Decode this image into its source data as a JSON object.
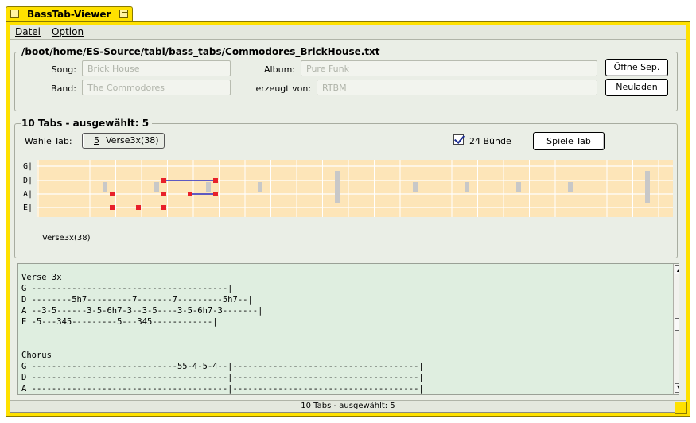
{
  "window": {
    "title": "BassTab-Viewer"
  },
  "menu": [
    {
      "label": "Datei"
    },
    {
      "label": "Option"
    }
  ],
  "info": {
    "path": "/boot/home/ES-Source/tabi/bass_tabs/Commodores_BrickHouse.txt",
    "song_label": "Song:",
    "song": "Brick House",
    "band_label": "Band:",
    "band": "The Commodores",
    "album_label": "Album:",
    "album": "Pure Funk",
    "creator_label": "erzeugt von:",
    "creator": "RTBM",
    "open_btn": "Öffne Sep.",
    "reload_btn": "Neuladen"
  },
  "tabs": {
    "header": "10 Tabs - ausgewählt:  5",
    "choose_label": "Wähle Tab:",
    "choose_num": "5",
    "choose_value": "Verse3x(38)",
    "frets_checked": true,
    "frets_label": "24 Bünde",
    "play_btn": "Spiele Tab",
    "string_labels": [
      "G|",
      "D|",
      "A|",
      "E|"
    ],
    "caption": "Verse3x(38)",
    "colors": {
      "note": "#e8202a",
      "link": "#2a2ac0",
      "marker": "#c8c8c8",
      "board": "#fde5b8"
    }
  },
  "text": {
    "content": "Verse 3x\nG|---------------------------------------|\nD|--------5h7---------7-------7---------5h7--|\nA|--3-5------3-5-6h7-3--3-5----3-5-6h7-3-------|\nE|-5---345---------5---345------------|\n\n\nChorus\nG|-----------------------------55-4-5-4--|-------------------------------------|\nD|---------------------------------------|-------------------------------------|\nA|---------------------------------------|-------------------------------------|"
  },
  "status": "10 Tabs - ausgewählt:  5"
}
